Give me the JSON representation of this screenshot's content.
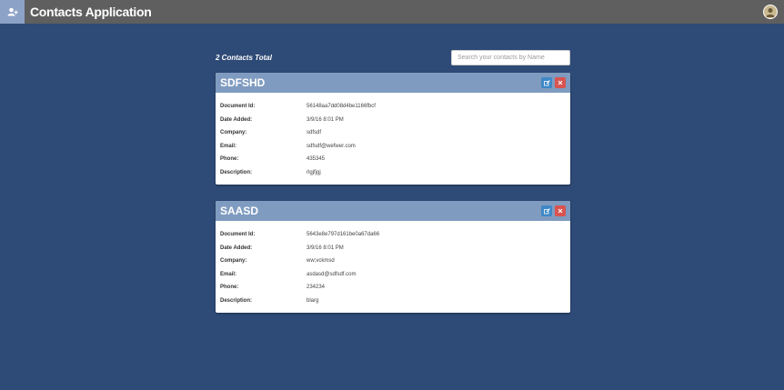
{
  "app": {
    "title": "Contacts Application",
    "add_icon": "add-user-icon",
    "avatar_icon": "user-avatar"
  },
  "summary": "2 Contacts Total",
  "search": {
    "placeholder": "Search your contacts by Name",
    "value": ""
  },
  "labels": {
    "document_id": "Document Id:",
    "date_added": "Date Added:",
    "company": "Company:",
    "email": "Email:",
    "phone": "Phone:",
    "description": "Description:"
  },
  "contacts": [
    {
      "name": "SDFSHD",
      "document_id": "56148aa7dd08d4be1166fbcf",
      "date_added": "3/9/16 8:01 PM",
      "company": "sdfsdf",
      "email": "sdfsdf@wefwer.com",
      "phone": "435345",
      "description": "rlgjfjgj"
    },
    {
      "name": "SAASD",
      "document_id": "5643e8e797d161be0a67da66",
      "date_added": "3/9/16 8:01 PM",
      "company": "ww;vckmsd",
      "email": "asdasd@sdfsdf.com",
      "phone": "234234",
      "description": "blarg"
    }
  ],
  "colors": {
    "background": "#2e4a76",
    "topbar": "#5f5f5f",
    "card_header": "#7f9bc0",
    "edit_button": "#3f88c6",
    "delete_button": "#d9534f"
  }
}
